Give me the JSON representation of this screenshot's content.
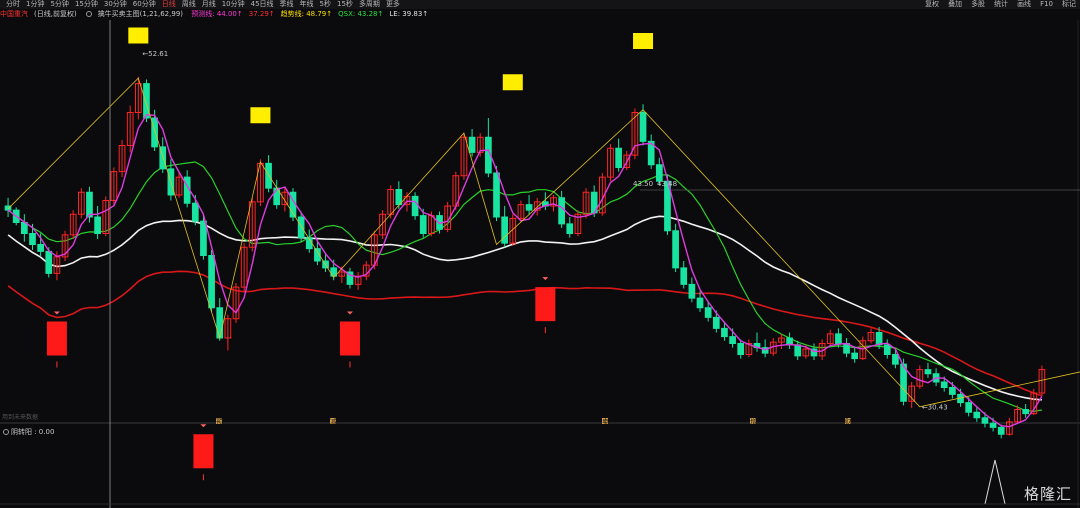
{
  "toolbar": {
    "periods": [
      "分时",
      "1分钟",
      "5分钟",
      "15分钟",
      "30分钟",
      "60分钟",
      "日线",
      "周线",
      "月线",
      "10分钟",
      "45日线",
      "季线",
      "年线",
      "5秒",
      "15秒",
      "多周期",
      "更多"
    ],
    "active_period": "日线",
    "right_buttons": [
      "复权",
      "叠加",
      "多股",
      "统计",
      "画线",
      "F10",
      "标记"
    ]
  },
  "legend": {
    "stock": "中国重汽",
    "mode": "(日线,前复权)",
    "indicator": "擒牛买卖主图(1,21,62,99)",
    "items": [
      {
        "label": "预测线:",
        "value": "44.00↑",
        "color": "#ff3bd6"
      },
      {
        "label": "",
        "value": "37.29↑",
        "color": "#ff3030"
      },
      {
        "label": "趋势线:",
        "value": "48.79↑",
        "color": "#ffe000"
      },
      {
        "label": "QSX:",
        "value": "43.28↑",
        "color": "#28e040"
      },
      {
        "label": "LE:",
        "value": "39.83↑",
        "color": "#e0e0e0"
      }
    ]
  },
  "sub": {
    "label": "阴转阳 : 0.00",
    "no_data": "用到未来数据"
  },
  "annotations": {
    "high": "52.61",
    "low": "30.43",
    "mid_a": "43.50",
    "mid_b": "43.48"
  },
  "markers": [
    {
      "text": "预",
      "x": 219
    },
    {
      "text": "减",
      "x": 333
    },
    {
      "text": "卖",
      "x": 605
    },
    {
      "text": "增",
      "x": 753
    },
    {
      "text": "财",
      "x": 848
    }
  ],
  "watermark": "格隆汇",
  "colors": {
    "up": "#ff2424",
    "down": "#19e3a0",
    "bg": "#0b0b0d",
    "magenta": "#e03ae0",
    "green": "#2ad02a",
    "white": "#f2f2f2",
    "red": "#d81818",
    "yellow": "#ffee00"
  },
  "chart_data": {
    "type": "candlestick",
    "ylim": [
      28,
      56
    ],
    "candles": [
      [
        43.2,
        43.8,
        42.4,
        42.9
      ],
      [
        42.9,
        43.1,
        41.8,
        42.0
      ],
      [
        42.0,
        42.6,
        40.6,
        41.2
      ],
      [
        41.2,
        41.9,
        40.0,
        40.4
      ],
      [
        40.4,
        41.2,
        39.5,
        39.9
      ],
      [
        39.9,
        40.2,
        38.0,
        38.3
      ],
      [
        38.3,
        39.9,
        37.8,
        39.5
      ],
      [
        39.5,
        41.4,
        39.2,
        41.1
      ],
      [
        41.1,
        42.9,
        40.8,
        42.6
      ],
      [
        42.6,
        44.5,
        42.3,
        44.2
      ],
      [
        44.2,
        44.6,
        42.0,
        42.4
      ],
      [
        42.4,
        43.2,
        40.8,
        41.2
      ],
      [
        41.2,
        43.9,
        41.0,
        43.6
      ],
      [
        43.6,
        46.0,
        43.2,
        45.7
      ],
      [
        45.7,
        48.0,
        45.3,
        47.6
      ],
      [
        47.6,
        50.5,
        47.1,
        50.0
      ],
      [
        50.0,
        52.6,
        49.5,
        52.1
      ],
      [
        52.1,
        52.4,
        49.3,
        49.6
      ],
      [
        49.6,
        50.2,
        47.2,
        47.5
      ],
      [
        47.5,
        48.2,
        45.6,
        45.9
      ],
      [
        45.9,
        46.6,
        43.6,
        44.0
      ],
      [
        44.0,
        45.7,
        43.8,
        45.3
      ],
      [
        45.3,
        45.8,
        43.1,
        43.4
      ],
      [
        43.4,
        44.0,
        41.8,
        42.1
      ],
      [
        42.1,
        42.5,
        39.3,
        39.6
      ],
      [
        39.6,
        40.0,
        35.5,
        35.8
      ],
      [
        35.8,
        36.5,
        33.4,
        33.6
      ],
      [
        33.6,
        35.3,
        32.7,
        35.0
      ],
      [
        35.0,
        37.6,
        34.7,
        37.3
      ],
      [
        37.3,
        40.5,
        37.0,
        40.2
      ],
      [
        40.2,
        43.8,
        39.9,
        43.5
      ],
      [
        43.5,
        46.6,
        43.2,
        46.3
      ],
      [
        46.3,
        46.9,
        44.2,
        44.5
      ],
      [
        44.5,
        45.1,
        43.0,
        43.3
      ],
      [
        43.3,
        44.6,
        42.8,
        44.2
      ],
      [
        44.2,
        44.5,
        42.1,
        42.4
      ],
      [
        42.4,
        42.8,
        40.6,
        40.9
      ],
      [
        40.9,
        41.5,
        39.8,
        40.1
      ],
      [
        40.1,
        40.6,
        38.9,
        39.2
      ],
      [
        39.2,
        39.7,
        38.4,
        38.7
      ],
      [
        38.7,
        39.3,
        37.8,
        38.1
      ],
      [
        38.1,
        38.8,
        37.6,
        38.4
      ],
      [
        38.4,
        38.7,
        37.2,
        37.5
      ],
      [
        37.5,
        38.4,
        37.1,
        38.1
      ],
      [
        38.1,
        39.2,
        37.8,
        38.9
      ],
      [
        38.9,
        41.4,
        38.6,
        41.1
      ],
      [
        41.1,
        42.9,
        40.8,
        42.6
      ],
      [
        42.6,
        44.7,
        42.3,
        44.4
      ],
      [
        44.4,
        45.0,
        43.0,
        43.3
      ],
      [
        43.3,
        44.2,
        42.8,
        43.9
      ],
      [
        43.9,
        44.2,
        42.2,
        42.5
      ],
      [
        42.5,
        43.0,
        40.9,
        41.2
      ],
      [
        41.2,
        42.8,
        41.0,
        42.5
      ],
      [
        42.5,
        42.8,
        41.2,
        41.5
      ],
      [
        41.5,
        43.5,
        41.3,
        43.2
      ],
      [
        43.2,
        45.7,
        42.9,
        45.4
      ],
      [
        45.4,
        48.5,
        45.1,
        48.2
      ],
      [
        48.2,
        48.8,
        46.8,
        47.1
      ],
      [
        47.1,
        48.5,
        46.8,
        48.2
      ],
      [
        48.2,
        49.6,
        45.3,
        45.6
      ],
      [
        45.6,
        46.1,
        42.1,
        42.4
      ],
      [
        42.4,
        43.2,
        40.2,
        40.5
      ],
      [
        40.5,
        42.6,
        40.3,
        42.3
      ],
      [
        42.3,
        43.6,
        42.0,
        43.3
      ],
      [
        43.3,
        44.0,
        42.6,
        42.9
      ],
      [
        42.9,
        43.8,
        42.5,
        43.5
      ],
      [
        43.5,
        44.2,
        42.9,
        43.2
      ],
      [
        43.2,
        44.0,
        42.8,
        43.8
      ],
      [
        43.8,
        44.3,
        41.6,
        41.9
      ],
      [
        41.9,
        42.4,
        40.9,
        41.2
      ],
      [
        41.2,
        42.9,
        41.0,
        42.6
      ],
      [
        42.6,
        44.5,
        42.3,
        44.2
      ],
      [
        44.2,
        44.7,
        42.4,
        42.7
      ],
      [
        42.7,
        45.6,
        42.5,
        45.3
      ],
      [
        45.3,
        47.7,
        45.0,
        47.4
      ],
      [
        47.4,
        48.1,
        45.7,
        46.0
      ],
      [
        46.0,
        47.2,
        45.8,
        46.9
      ],
      [
        46.9,
        50.3,
        46.6,
        50.0
      ],
      [
        50.0,
        50.6,
        47.6,
        47.9
      ],
      [
        47.9,
        48.4,
        45.9,
        46.2
      ],
      [
        46.2,
        46.7,
        44.7,
        45.0
      ],
      [
        45.0,
        45.5,
        41.1,
        41.4
      ],
      [
        41.4,
        41.9,
        38.4,
        38.7
      ],
      [
        38.7,
        39.2,
        37.2,
        37.5
      ],
      [
        37.5,
        38.0,
        36.2,
        36.5
      ],
      [
        36.5,
        37.0,
        35.5,
        35.8
      ],
      [
        35.8,
        36.3,
        34.8,
        35.1
      ],
      [
        35.1,
        35.6,
        34.0,
        34.3
      ],
      [
        34.3,
        34.8,
        33.4,
        33.7
      ],
      [
        33.7,
        34.3,
        32.9,
        33.2
      ],
      [
        33.2,
        33.5,
        32.1,
        32.4
      ],
      [
        32.4,
        33.5,
        32.2,
        33.2
      ],
      [
        33.2,
        34.0,
        32.6,
        32.9
      ],
      [
        32.9,
        33.5,
        32.2,
        32.5
      ],
      [
        32.5,
        33.6,
        32.3,
        33.3
      ],
      [
        33.3,
        33.9,
        32.8,
        33.6
      ],
      [
        33.6,
        34.0,
        32.8,
        33.1
      ],
      [
        33.1,
        33.4,
        32.0,
        32.3
      ],
      [
        32.3,
        33.1,
        32.1,
        32.8
      ],
      [
        32.8,
        33.2,
        32.0,
        32.3
      ],
      [
        32.3,
        33.5,
        32.0,
        33.2
      ],
      [
        33.2,
        34.2,
        33.0,
        33.9
      ],
      [
        33.9,
        34.3,
        32.9,
        33.2
      ],
      [
        33.2,
        33.6,
        32.2,
        32.5
      ],
      [
        32.5,
        33.0,
        31.8,
        32.1
      ],
      [
        32.1,
        33.7,
        32.0,
        33.4
      ],
      [
        33.4,
        34.3,
        33.2,
        34.0
      ],
      [
        34.0,
        34.4,
        32.8,
        33.1
      ],
      [
        33.1,
        33.5,
        32.1,
        32.4
      ],
      [
        32.4,
        32.8,
        31.4,
        31.7
      ],
      [
        31.7,
        32.1,
        28.7,
        29.0
      ],
      [
        29.0,
        30.4,
        28.5,
        30.1
      ],
      [
        30.1,
        31.6,
        29.9,
        31.3
      ],
      [
        31.3,
        31.8,
        30.7,
        31.0
      ],
      [
        31.0,
        31.4,
        30.1,
        30.4
      ],
      [
        30.4,
        30.8,
        29.7,
        30.0
      ],
      [
        30.0,
        30.4,
        29.2,
        29.5
      ],
      [
        29.5,
        29.9,
        28.6,
        28.9
      ],
      [
        28.9,
        29.3,
        27.9,
        28.2
      ],
      [
        28.2,
        28.6,
        27.5,
        27.8
      ],
      [
        27.8,
        28.2,
        27.1,
        27.4
      ],
      [
        27.4,
        27.8,
        26.8,
        27.1
      ],
      [
        27.1,
        27.3,
        26.3,
        26.6
      ],
      [
        26.6,
        27.8,
        26.5,
        27.5
      ],
      [
        27.5,
        28.7,
        27.4,
        28.4
      ],
      [
        28.4,
        28.8,
        27.8,
        28.1
      ],
      [
        28.1,
        29.9,
        28.0,
        29.6
      ],
      [
        29.6,
        31.6,
        29.4,
        31.3
      ]
    ]
  }
}
